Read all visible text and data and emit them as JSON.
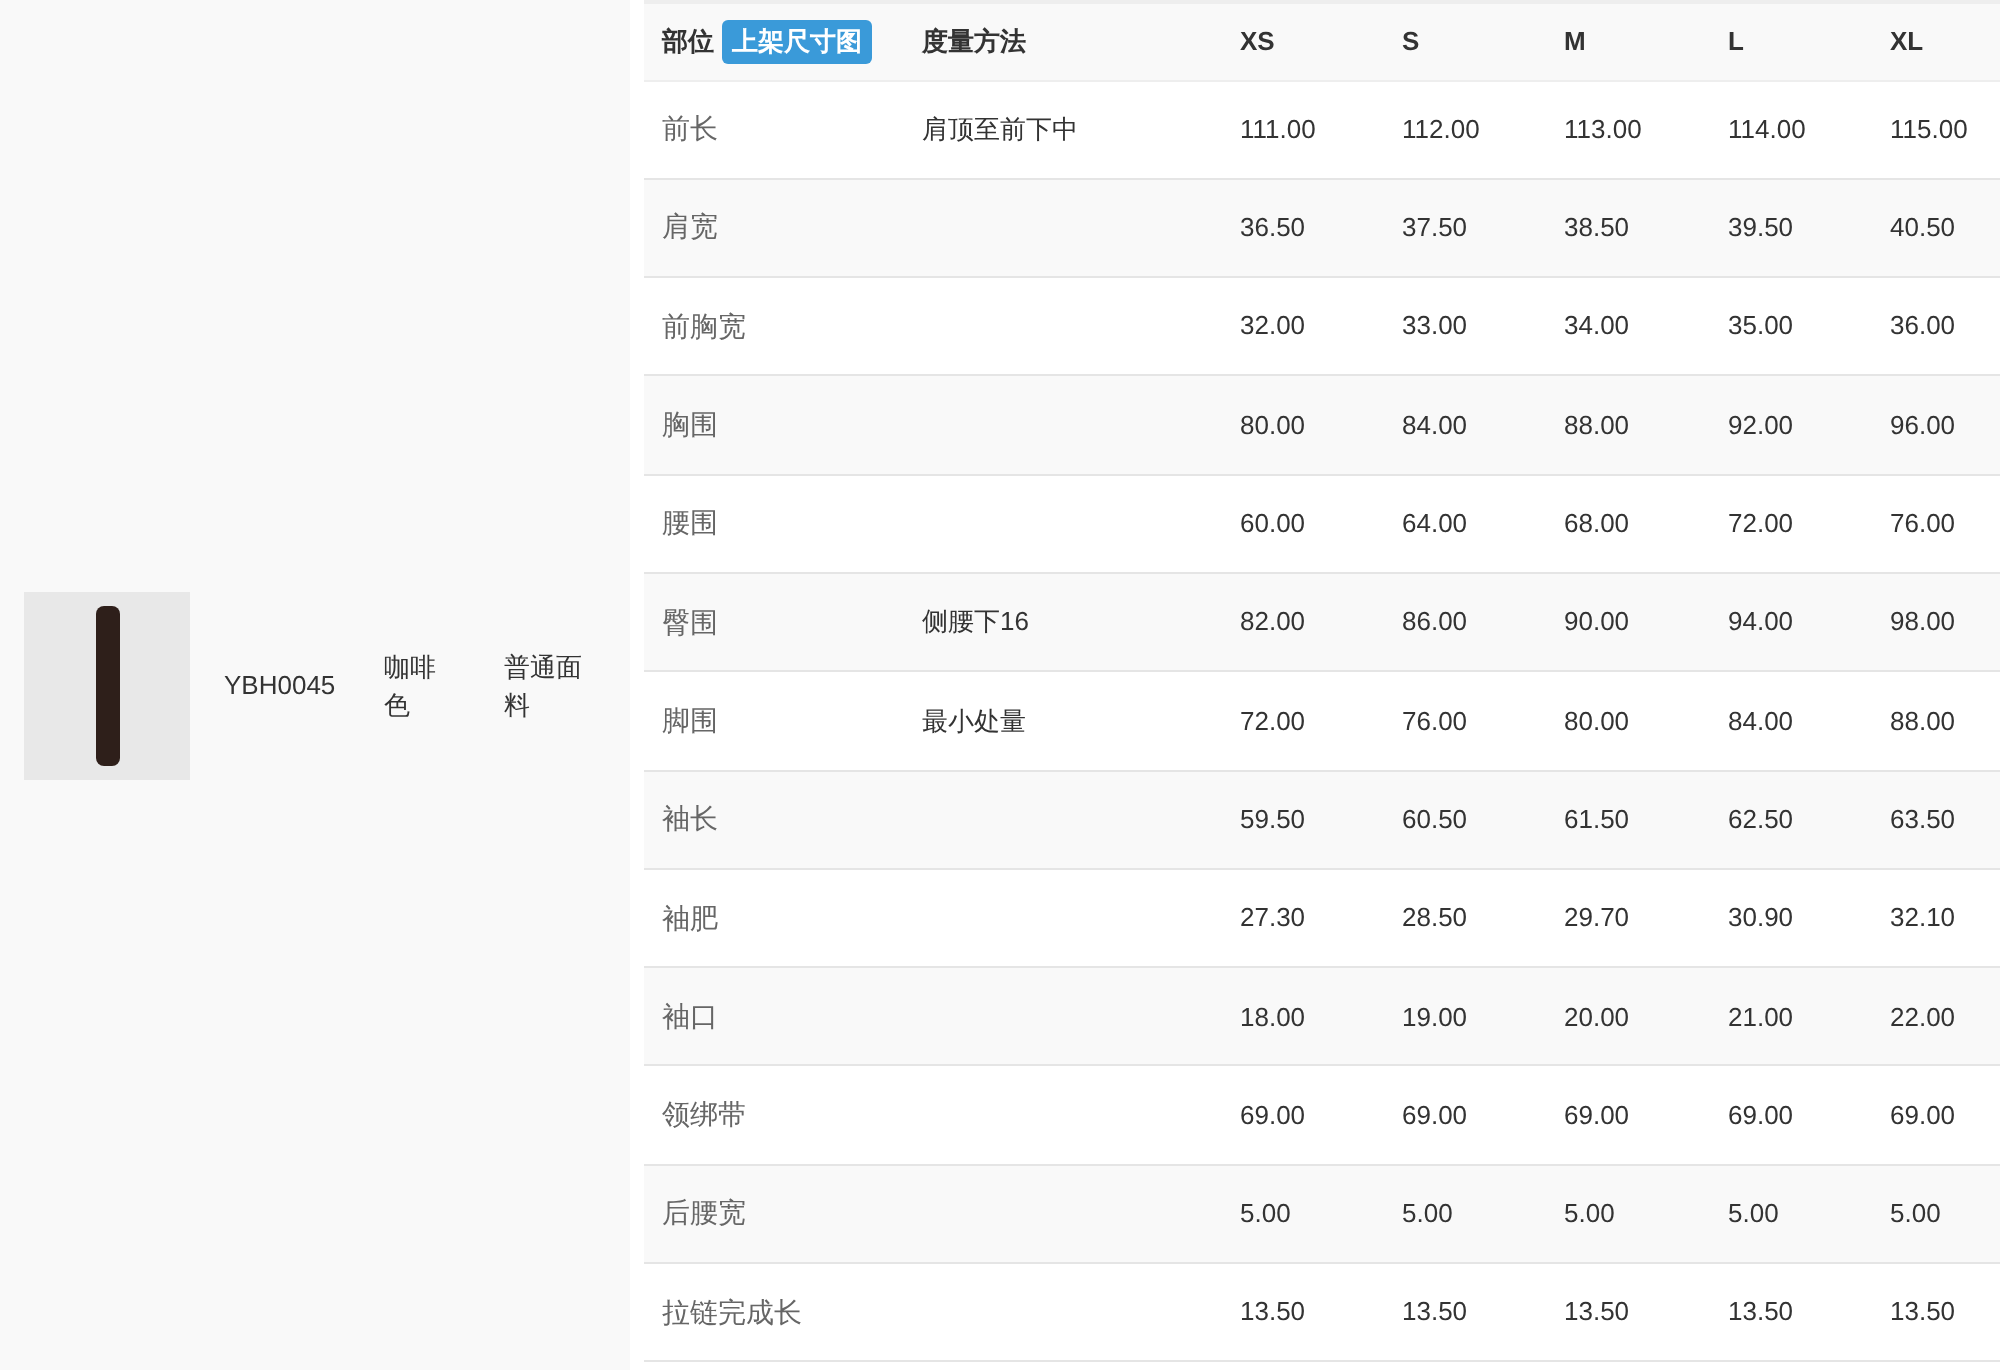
{
  "product": {
    "code": "YBH0045",
    "variant": "咖啡色",
    "fabric": "普通面料"
  },
  "table": {
    "columns": [
      "部位",
      "度量方法",
      "XS",
      "S",
      "M",
      "L",
      "XL"
    ],
    "header_button": "上架尺寸图",
    "rows": [
      {
        "part": "前长",
        "method": "肩顶至前下中",
        "values": [
          "111.00",
          "112.00",
          "113.00",
          "114.00",
          "115.00"
        ]
      },
      {
        "part": "肩宽",
        "values": [
          "36.50",
          "37.50",
          "38.50",
          "39.50",
          "40.50"
        ]
      },
      {
        "part": "前胸宽",
        "values": [
          "32.00",
          "33.00",
          "34.00",
          "35.00",
          "36.00"
        ]
      },
      {
        "part": "胸围",
        "values": [
          "80.00",
          "84.00",
          "88.00",
          "92.00",
          "96.00"
        ]
      },
      {
        "part": "腰围",
        "values": [
          "60.00",
          "64.00",
          "68.00",
          "72.00",
          "76.00"
        ]
      },
      {
        "part": "臀围",
        "method": "侧腰下16",
        "values": [
          "82.00",
          "86.00",
          "90.00",
          "94.00",
          "98.00"
        ]
      },
      {
        "part": "脚围",
        "method": "最小处量",
        "values": [
          "72.00",
          "76.00",
          "80.00",
          "84.00",
          "88.00"
        ]
      },
      {
        "part": "袖长",
        "values": [
          "59.50",
          "60.50",
          "61.50",
          "62.50",
          "63.50"
        ]
      },
      {
        "part": "袖肥",
        "values": [
          "27.30",
          "28.50",
          "29.70",
          "30.90",
          "32.10"
        ]
      },
      {
        "part": "袖口",
        "values": [
          "18.00",
          "19.00",
          "20.00",
          "21.00",
          "22.00"
        ]
      },
      {
        "part": "领绑带",
        "values": [
          "69.00",
          "69.00",
          "69.00",
          "69.00",
          "69.00"
        ]
      },
      {
        "part": "后腰宽",
        "values": [
          "5.00",
          "5.00",
          "5.00",
          "5.00",
          "5.00"
        ]
      },
      {
        "part": "拉链完成长",
        "values": [
          "13.50",
          "13.50",
          "13.50",
          "13.50",
          "13.50"
        ]
      }
    ]
  }
}
